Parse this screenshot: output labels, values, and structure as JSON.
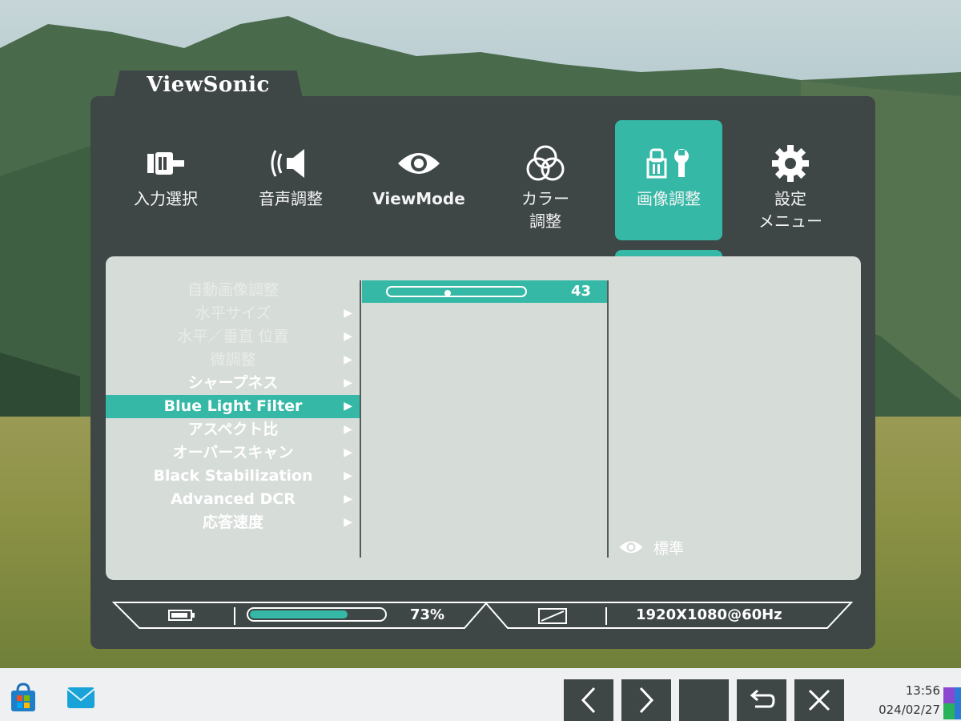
{
  "osd": {
    "brand": "ViewSonic",
    "tabs": [
      {
        "label": "入力選択",
        "icon": "input-plug-icon",
        "active": false
      },
      {
        "label": "音声調整",
        "icon": "speaker-icon",
        "active": false
      },
      {
        "label": "ViewMode",
        "icon": "eye-icon",
        "active": false
      },
      {
        "label": "カラー\n調整",
        "icon": "color-circles-icon",
        "active": false
      },
      {
        "label": "画像調整",
        "icon": "image-adjust-tools-icon",
        "active": true
      },
      {
        "label": "設定\nメニュー",
        "icon": "gear-icon",
        "active": false
      }
    ],
    "menu": [
      {
        "label": "自動画像調整",
        "enabled": false,
        "has_arrow": false
      },
      {
        "label": "水平サイズ",
        "enabled": false,
        "has_arrow": true
      },
      {
        "label": "水平／垂直 位置",
        "enabled": false,
        "has_arrow": true
      },
      {
        "label": "微調整",
        "enabled": false,
        "has_arrow": true
      },
      {
        "label": "シャープネス",
        "enabled": true,
        "has_arrow": true
      },
      {
        "label": "Blue Light Filter",
        "enabled": true,
        "has_arrow": true,
        "selected": true
      },
      {
        "label": "アスペクト比",
        "enabled": true,
        "has_arrow": true
      },
      {
        "label": "オーバースキャン",
        "enabled": true,
        "has_arrow": true
      },
      {
        "label": "Black Stabilization",
        "enabled": true,
        "has_arrow": true
      },
      {
        "label": "Advanced DCR",
        "enabled": true,
        "has_arrow": true
      },
      {
        "label": "応答速度",
        "enabled": true,
        "has_arrow": true
      }
    ],
    "arrow_glyph": "▶",
    "slider": {
      "value": "43",
      "level": 0.43
    },
    "viewmode_status": "標準",
    "status": {
      "brightness_text": "73%",
      "brightness_level": 0.73,
      "resolution": "1920X1080@60Hz"
    }
  },
  "taskbar": {
    "time": "13:56",
    "date": "024/02/27"
  },
  "colors": {
    "accent": "#35b8a6",
    "panel": "#3e4646",
    "content": "#d6dcd8"
  }
}
